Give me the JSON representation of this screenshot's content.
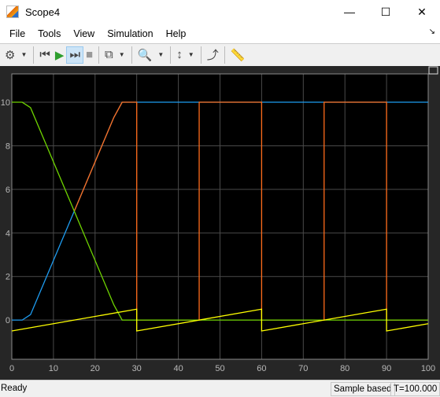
{
  "window": {
    "title": "Scope4",
    "minimize": "—",
    "maximize": "☐",
    "close": "✕"
  },
  "menu": [
    "File",
    "Tools",
    "View",
    "Simulation",
    "Help"
  ],
  "toolbar": [
    {
      "name": "settings",
      "glyph": "⚙",
      "dropdown": true
    },
    {
      "name": "step-back",
      "glyph": "⏮"
    },
    {
      "name": "run",
      "glyph": "▶"
    },
    {
      "name": "step-forward",
      "glyph": "⏭",
      "active": true
    },
    {
      "name": "stop",
      "glyph": "■"
    },
    {
      "name": "highlight-block",
      "glyph": "⧉",
      "dropdown": true
    },
    {
      "name": "zoom-in",
      "glyph": "🔍",
      "dropdown": true
    },
    {
      "name": "scale-axes",
      "glyph": "↕",
      "dropdown": true
    },
    {
      "name": "triggers",
      "glyph": "⤴"
    },
    {
      "name": "measurements",
      "glyph": "📏"
    }
  ],
  "status": {
    "left": "Ready",
    "mode": "Sample based",
    "time": "T=100.000"
  },
  "chart_data": {
    "type": "line",
    "xlim": [
      0,
      100
    ],
    "ylim": [
      -1.8,
      11.3
    ],
    "xticks": [
      0,
      10,
      20,
      30,
      40,
      50,
      60,
      70,
      80,
      90,
      100
    ],
    "yticks": [
      0,
      2,
      4,
      6,
      8,
      10
    ],
    "grid": true,
    "background": "#000000",
    "series": [
      {
        "color": "#1e9cf0",
        "points": [
          [
            0,
            0
          ],
          [
            2.5,
            0
          ],
          [
            4.5,
            0.25
          ],
          [
            15,
            5
          ],
          [
            24.5,
            9.3
          ],
          [
            26.5,
            10
          ],
          [
            100,
            10
          ]
        ]
      },
      {
        "color": "#ff6b1a",
        "points": [
          [
            15,
            5
          ],
          [
            24.5,
            9.3
          ],
          [
            26.5,
            10
          ],
          [
            30,
            10
          ],
          [
            30,
            0
          ],
          [
            45,
            0
          ],
          [
            45,
            10
          ],
          [
            60,
            10
          ],
          [
            60,
            0
          ],
          [
            75,
            0
          ],
          [
            75,
            10
          ],
          [
            90,
            10
          ],
          [
            90,
            0
          ],
          [
            100,
            0
          ]
        ]
      },
      {
        "color": "#6fd400",
        "points": [
          [
            0,
            10
          ],
          [
            2.5,
            10
          ],
          [
            4.5,
            9.75
          ],
          [
            24.5,
            0.7
          ],
          [
            26.5,
            0
          ],
          [
            100,
            0
          ]
        ]
      },
      {
        "color": "#ffff00",
        "points": [
          [
            0,
            -0.5
          ],
          [
            30,
            0.5
          ],
          [
            30,
            -0.5
          ],
          [
            60,
            0.5
          ],
          [
            60,
            -0.5
          ],
          [
            90,
            0.5
          ],
          [
            90,
            -0.5
          ],
          [
            100,
            -0.167
          ]
        ]
      }
    ]
  }
}
